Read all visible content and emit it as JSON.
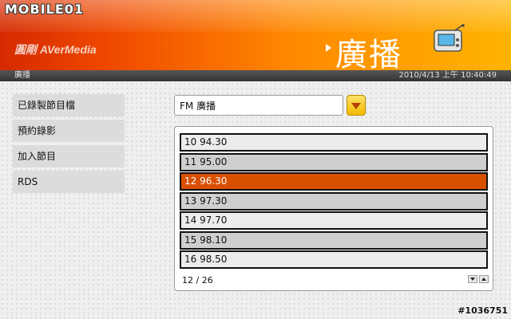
{
  "header": {
    "logo_text": "MOBILE01",
    "brand": "圓剛 AVerMedia",
    "title": "廣播"
  },
  "statusbar": {
    "breadcrumb": "廣播",
    "datetime": "2010/4/13 上午 10:40:49"
  },
  "sidebar": {
    "items": [
      {
        "label": "已錄製節目檔"
      },
      {
        "label": "預約錄影"
      },
      {
        "label": "加入節目"
      },
      {
        "label": "RDS"
      }
    ]
  },
  "source_select": {
    "value": "FM 廣播"
  },
  "channels": {
    "rows": [
      {
        "label": "10  94.30"
      },
      {
        "label": "11  95.00"
      },
      {
        "label": "12  96.30"
      },
      {
        "label": "13  97.30"
      },
      {
        "label": "14  97.70"
      },
      {
        "label": "15  98.10"
      },
      {
        "label": "16  98.50"
      }
    ],
    "selected_index": 2,
    "pager": "12 / 26"
  },
  "watermark": "#1036751",
  "colors": {
    "accent": "#d94f00",
    "header_start": "#d52a00",
    "header_end": "#ffb400"
  }
}
